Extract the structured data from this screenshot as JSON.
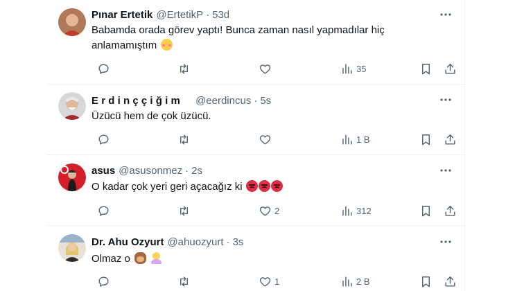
{
  "icons": {
    "reply": "reply-icon",
    "retweet": "retweet-icon",
    "like": "heart-icon",
    "views": "views-icon",
    "bookmark": "bookmark-icon",
    "share": "share-icon",
    "more": "more-icon"
  },
  "colors": {
    "secondary_text": "#536471",
    "divider": "#eff3f4"
  },
  "tweets": [
    {
      "name": "Pınar Ertetik",
      "handle": "@ErtetikP",
      "sep": "·",
      "time": "53d",
      "text_line1": "Babamda orada görev yaptı! Bunca zaman nasıl yapmadılar hiç",
      "text_line2": "anlamamıştım",
      "emojis": [
        "blush-emoji"
      ],
      "counts": {
        "reply": "",
        "retweet": "",
        "like": "",
        "views": "35"
      }
    },
    {
      "name": "Erdinççiğim",
      "handle": "@eerdincus",
      "sep": "·",
      "time": "5s",
      "text_line1": "Üzücü hem de çok üzücü.",
      "counts": {
        "reply": "",
        "retweet": "",
        "like": "",
        "views": "1 B"
      }
    },
    {
      "name": "asus",
      "handle": "@asusonmez",
      "sep": "·",
      "time": "2s",
      "text_line1": "O kadar çok yeri geri açacağız ki",
      "emojis": [
        "angry-emoji",
        "angry-emoji",
        "angry-emoji"
      ],
      "counts": {
        "reply": "",
        "retweet": "",
        "like": "2",
        "views": "312"
      }
    },
    {
      "name": "Dr. Ahu Ozyurt",
      "handle": "@ahuozyurt",
      "sep": "·",
      "time": "3s",
      "text_line1": "Olmaz o",
      "emojis": [
        "see-no-evil-monkey-emoji",
        "woman-facepalming-emoji"
      ],
      "counts": {
        "reply": "",
        "retweet": "",
        "like": "1",
        "views": "2 B"
      }
    }
  ]
}
